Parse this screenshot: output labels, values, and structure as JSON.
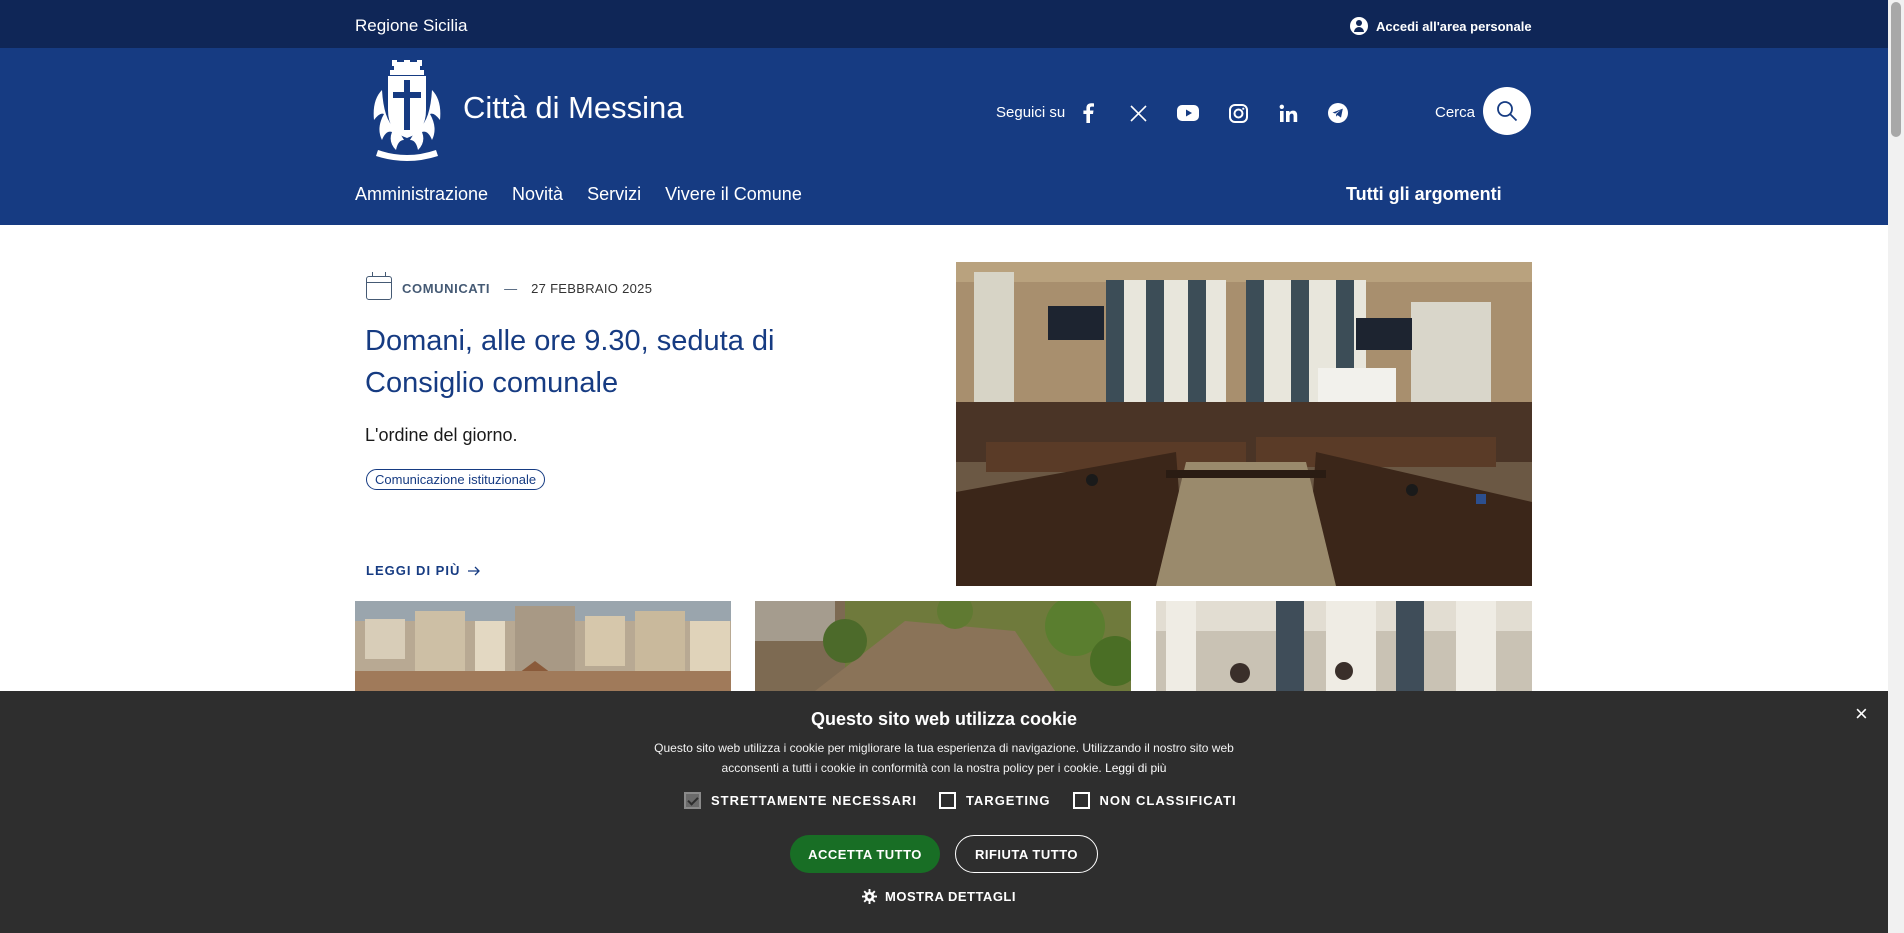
{
  "topbar": {
    "region": "Regione Sicilia",
    "login": "Accedi all'area personale"
  },
  "header": {
    "title": "Città di Messina",
    "follow_label": "Seguici su",
    "social_icons": [
      "facebook-icon",
      "x-icon",
      "youtube-icon",
      "instagram-icon",
      "linkedin-icon",
      "telegram-icon"
    ],
    "search_label": "Cerca"
  },
  "nav": {
    "items": [
      "Amministrazione",
      "Novità",
      "Servizi",
      "Vivere il Comune"
    ],
    "all_topics": "Tutti gli argomenti"
  },
  "feature": {
    "category": "COMUNICATI",
    "dash": "—",
    "date": "27 FEBBRAIO 2025",
    "title": "Domani, alle ore 9.30, seduta di Consiglio comunale",
    "description": "L'ordine del giorno.",
    "tag": "Comunicazione istituzionale",
    "read_more": "LEGGI DI PIÙ"
  },
  "cookie": {
    "title": "Questo sito web utilizza cookie",
    "text": "Questo sito web utilizza i cookie per migliorare la tua esperienza di navigazione. Utilizzando il nostro sito web acconsenti a tutti i cookie in conformità con la nostra policy per i cookie.",
    "learn_more": "Leggi di più",
    "options": [
      {
        "label": "STRETTAMENTE NECESSARI",
        "checked": true
      },
      {
        "label": "TARGETING",
        "checked": false
      },
      {
        "label": "NON CLASSIFICATI",
        "checked": false
      }
    ],
    "accept": "ACCETTA TUTTO",
    "reject": "RIFIUTA TUTTO",
    "details": "MOSTRA DETTAGLI",
    "close": "×"
  },
  "colors": {
    "topbar": "#0f2657",
    "header": "#163b82",
    "accent": "#163b82",
    "accept_button": "#186e25",
    "cookie_bg": "#2e2e2e"
  }
}
